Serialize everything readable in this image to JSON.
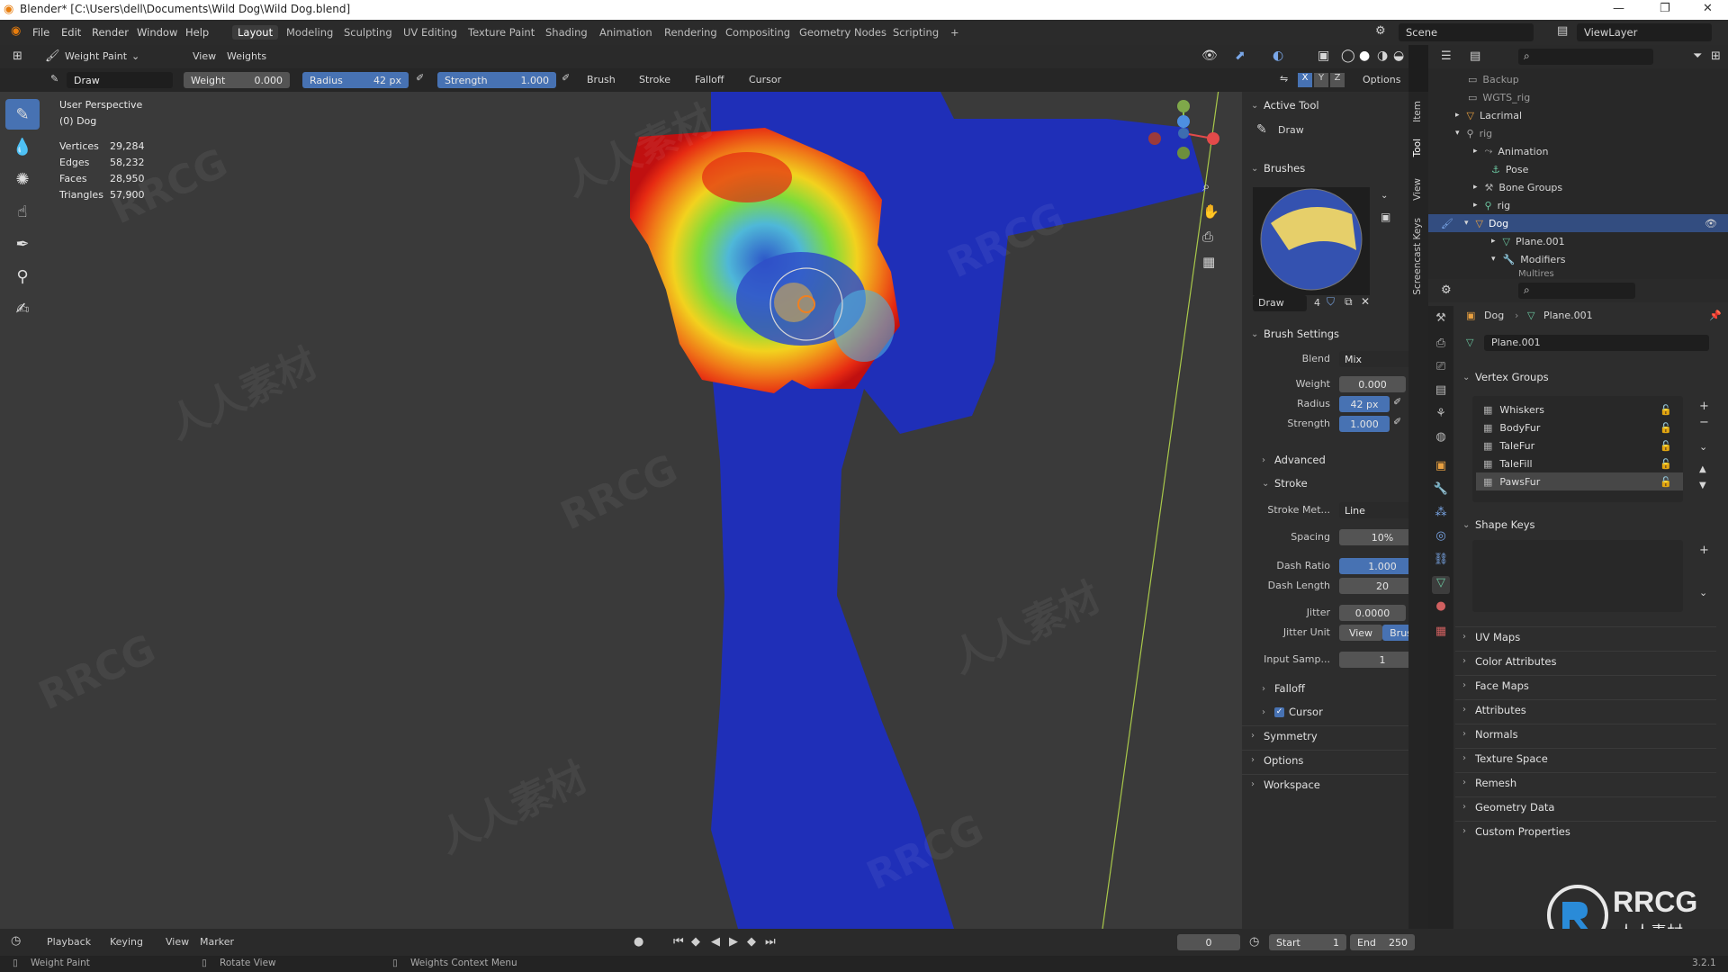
{
  "titlebar": {
    "title": "Blender* [C:\\Users\\dell\\Documents\\Wild Dog\\Wild Dog.blend]",
    "minimize": "—",
    "maximize": "❐",
    "close": "✕"
  },
  "menu": {
    "file": "File",
    "edit": "Edit",
    "render": "Render",
    "window": "Window",
    "help": "Help"
  },
  "workspaces": [
    "Layout",
    "Modeling",
    "Sculpting",
    "UV Editing",
    "Texture Paint",
    "Shading",
    "Animation",
    "Rendering",
    "Compositing",
    "Geometry Nodes",
    "Scripting",
    "+"
  ],
  "scene": {
    "label": "Scene",
    "viewlayer": "ViewLayer"
  },
  "viewport_header": {
    "mode": "Weight Paint",
    "view": "View",
    "weights": "Weights",
    "options": "Options"
  },
  "tool_header": {
    "tool": "Draw",
    "weight_label": "Weight",
    "weight_value": "0.000",
    "radius_label": "Radius",
    "radius_value": "42 px",
    "strength_label": "Strength",
    "strength_value": "1.000",
    "brush": "Brush",
    "stroke": "Stroke",
    "falloff": "Falloff",
    "cursor": "Cursor"
  },
  "overlay": {
    "perspective": "User Perspective",
    "object": "(0) Dog",
    "stats": [
      {
        "label": "Vertices",
        "value": "29,284"
      },
      {
        "label": "Edges",
        "value": "58,232"
      },
      {
        "label": "Faces",
        "value": "28,950"
      },
      {
        "label": "Triangles",
        "value": "57,900"
      }
    ]
  },
  "npanel": {
    "active_tool": "Active Tool",
    "tool_name": "Draw",
    "brushes": "Brushes",
    "brush_name": "Draw",
    "brush_users": "4",
    "brush_settings": "Brush Settings",
    "blend_label": "Blend",
    "blend_value": "Mix",
    "weight_label": "Weight",
    "weight_value": "0.000",
    "radius_label": "Radius",
    "radius_value": "42 px",
    "strength_label": "Strength",
    "strength_value": "1.000",
    "advanced": "Advanced",
    "stroke": "Stroke",
    "stroke_method_label": "Stroke Met...",
    "stroke_method_value": "Line",
    "spacing_label": "Spacing",
    "spacing_value": "10%",
    "dash_ratio_label": "Dash Ratio",
    "dash_ratio_value": "1.000",
    "dash_length_label": "Dash Length",
    "dash_length_value": "20",
    "jitter_label": "Jitter",
    "jitter_value": "0.0000",
    "jitter_unit_label": "Jitter Unit",
    "jitter_unit_view": "View",
    "jitter_unit_brush": "Brush",
    "input_samples_label": "Input Samp...",
    "input_samples_value": "1",
    "falloff": "Falloff",
    "cursor": "Cursor",
    "symmetry": "Symmetry",
    "options": "Options",
    "workspace": "Workspace"
  },
  "sidetabs": [
    "Item",
    "Tool",
    "View",
    "Screencast Keys"
  ],
  "outliner": {
    "rows": [
      "Backup",
      "WGTS_rig",
      "Lacrimal",
      "rig",
      "Animation",
      "Pose",
      "Bone Groups",
      "rig",
      "Dog",
      "Plane.001",
      "Modifiers",
      "Multires"
    ]
  },
  "properties": {
    "breadcrumb_object": "Dog",
    "breadcrumb_mesh": "Plane.001",
    "mesh_name": "Plane.001",
    "vertex_groups": "Vertex Groups",
    "groups": [
      "Whiskers",
      "BodyFur",
      "TaleFur",
      "TaleFill",
      "PawsFur"
    ],
    "shape_keys": "Shape Keys",
    "sections": [
      "UV Maps",
      "Color Attributes",
      "Face Maps",
      "Attributes",
      "Normals",
      "Texture Space",
      "Remesh",
      "Geometry Data",
      "Custom Properties"
    ]
  },
  "timeline": {
    "playback": "Playback",
    "keying": "Keying",
    "view": "View",
    "marker": "Marker",
    "current_frame": "0",
    "start_label": "Start",
    "start_value": "1",
    "end_label": "End",
    "end_value": "250"
  },
  "statusbar": {
    "left": "Weight Paint",
    "mid": "Rotate View",
    "right": "Weights Context Menu",
    "version": "3.2.1"
  },
  "watermark": {
    "text": "RRCG",
    "cn": "人人素材",
    "cn2": "人人素材"
  }
}
